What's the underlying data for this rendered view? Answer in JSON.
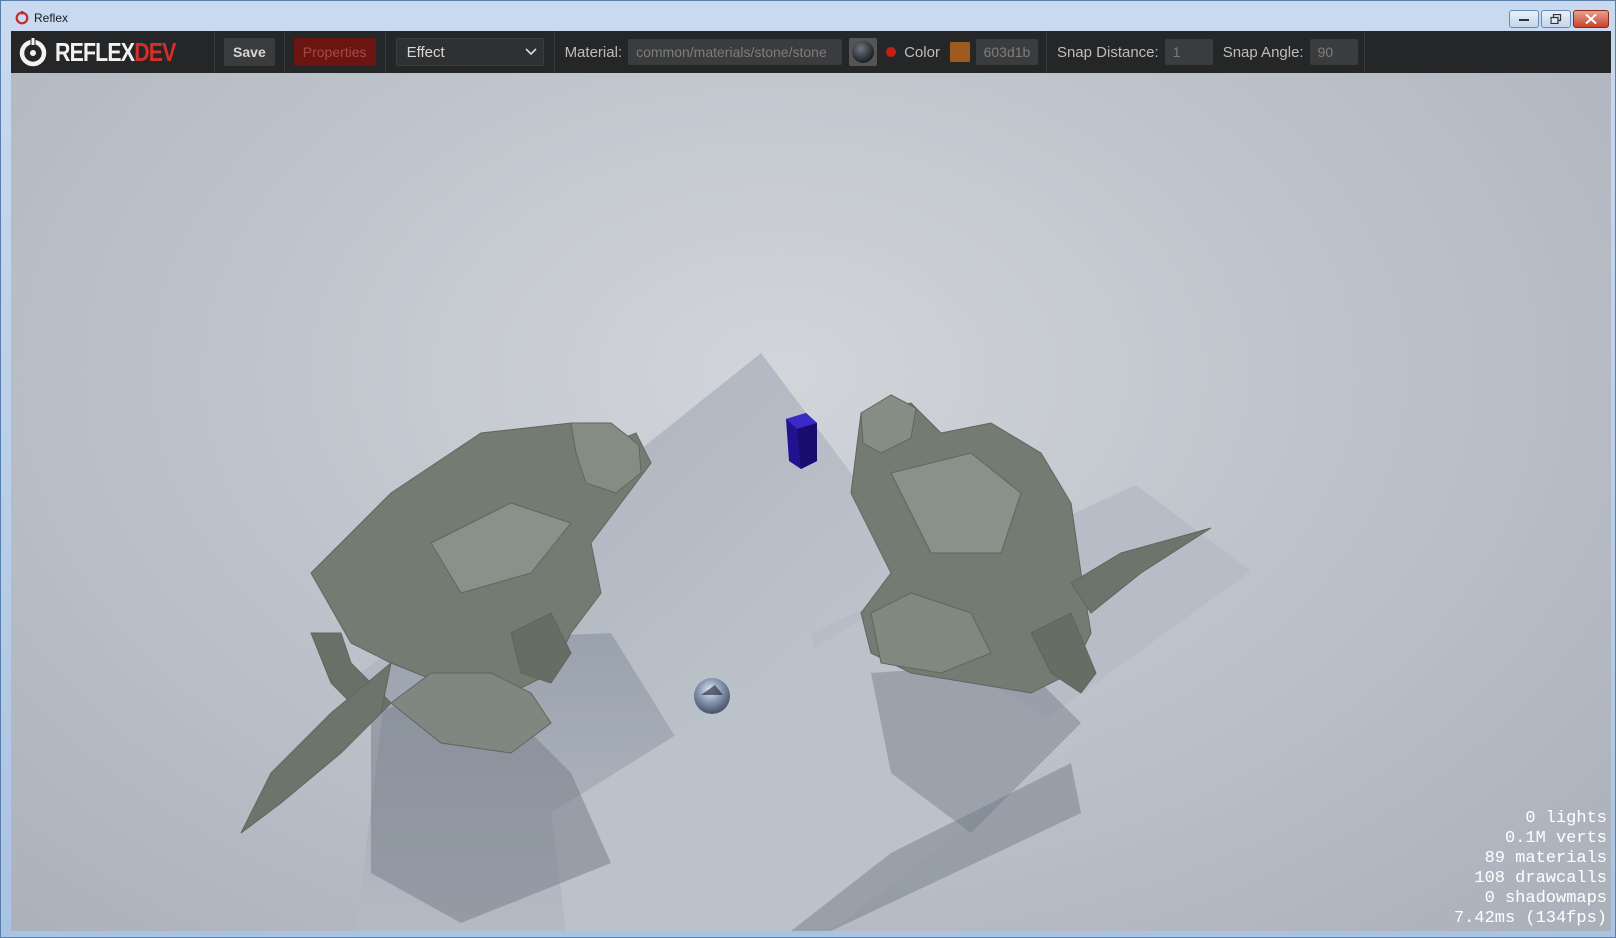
{
  "window": {
    "title": "Reflex"
  },
  "toolbar": {
    "logo_main": "REFLEX",
    "logo_accent": "DEV",
    "save_label": "Save",
    "properties_label": "Properties",
    "effect_select": {
      "selected": "Effect"
    },
    "material_label": "Material:",
    "material_value": "common/materials/stone/stone",
    "color_label": "Color",
    "color_hex": "603d1b",
    "snap_distance_label": "Snap Distance:",
    "snap_distance_value": "1",
    "snap_angle_label": "Snap Angle:",
    "snap_angle_value": "90"
  },
  "colors": {
    "toolbar_bg": "#252627",
    "accent_red": "#d3302a",
    "color_swatch": "#9c5a1f"
  },
  "stats": [
    "0 lights",
    "0.1M verts",
    "89 materials",
    "108 drawcalls",
    "0 shadowmaps",
    "7.42ms (134fps)"
  ]
}
